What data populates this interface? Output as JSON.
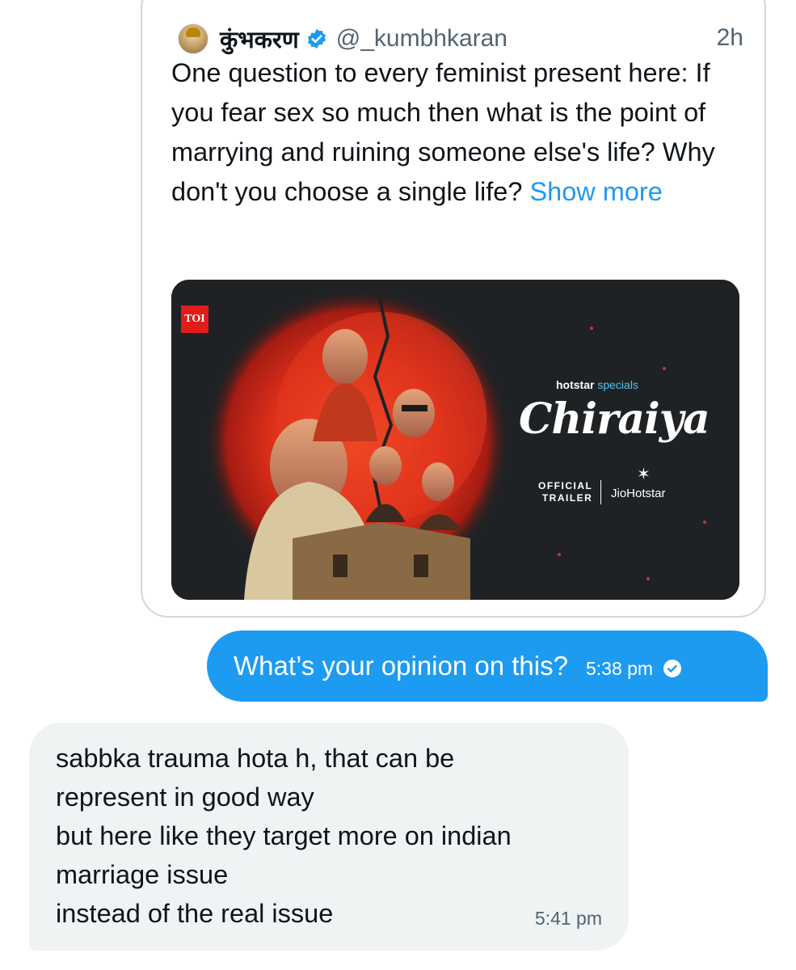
{
  "quoted_tweet": {
    "display_name": "कुंभकरण",
    "handle": "@_kumbhkaran",
    "time": "2h",
    "text": "One question to every feminist present here: If you fear sex so much then what is the point of marrying and ruining someone else's life? Why don't you choose a single life?",
    "show_more": "Show more",
    "media": {
      "badge": "TOI",
      "brand": "hotstar",
      "brand_suffix": "specials",
      "title": "Chiraiya",
      "trailer_line1": "OFFICIAL",
      "trailer_line2": "TRAILER",
      "partner": "JioHotstar"
    }
  },
  "messages": {
    "sent": {
      "text": "What’s your opinion on this?",
      "time": "5:38 pm"
    },
    "received": {
      "lines": [
        "sabbka trauma hota h,  that can be",
        "represent in good way",
        "but here like they target more on indian",
        "marriage issue",
        "instead of the real issue"
      ],
      "time": "5:41 pm"
    }
  },
  "colors": {
    "accent": "#1d9bf0",
    "text_primary": "#0f1419",
    "text_secondary": "#536471",
    "received_bg": "#eff3f4",
    "card_border": "#cfd9de"
  },
  "icons": {
    "verified": "verified-badge-icon",
    "seen": "check-circle-icon"
  }
}
